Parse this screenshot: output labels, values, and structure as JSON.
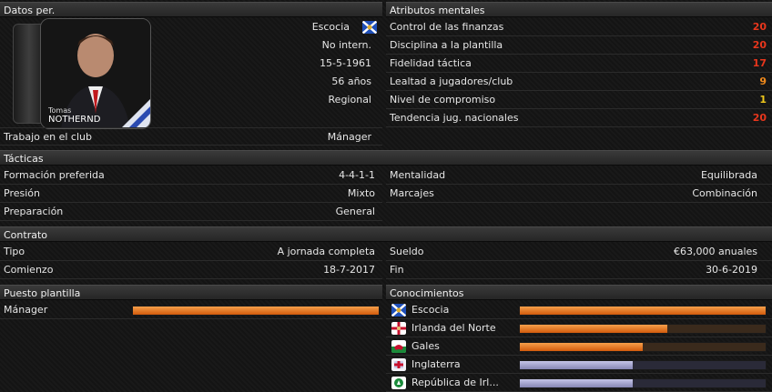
{
  "personal": {
    "header": "Datos per.",
    "nationality": "Escocia",
    "international": "No intern.",
    "birth_date": "15-5-1961",
    "age": "56 años",
    "reputation": "Regional",
    "photo_first_name": "Tomas",
    "photo_last_name": "NOTHERND",
    "job_label": "Trabajo en el club",
    "job_value": "Mánager"
  },
  "mental": {
    "header": "Atributos mentales",
    "items": [
      {
        "label": "Control de las finanzas",
        "value": "20",
        "color": "#e8361c"
      },
      {
        "label": "Disciplina a la plantilla",
        "value": "20",
        "color": "#e8361c"
      },
      {
        "label": "Fidelidad táctica",
        "value": "17",
        "color": "#e8361c"
      },
      {
        "label": "Lealtad a jugadores/club",
        "value": "9",
        "color": "#f08a1c"
      },
      {
        "label": "Nivel de compromiso",
        "value": "1",
        "color": "#f0c81c"
      },
      {
        "label": "Tendencia jug. nacionales",
        "value": "20",
        "color": "#e8361c"
      }
    ]
  },
  "tactics": {
    "header": "Tácticas",
    "formation_label": "Formación preferida",
    "formation_value": "4-4-1-1",
    "mentality_label": "Mentalidad",
    "mentality_value": "Equilibrada",
    "pressing_label": "Presión",
    "pressing_value": "Mixto",
    "marking_label": "Marcajes",
    "marking_value": "Combinación",
    "training_label": "Preparación",
    "training_value": "General"
  },
  "contract": {
    "header": "Contrato",
    "type_label": "Tipo",
    "type_value": "A jornada completa",
    "wage_label": "Sueldo",
    "wage_value": "€63,000 anuales",
    "start_label": "Comienzo",
    "start_value": "18-7-2017",
    "end_label": "Fin",
    "end_value": "30-6-2019"
  },
  "squad_role": {
    "header": "Puesto plantilla",
    "label": "Mánager",
    "fraction": 1.0
  },
  "knowledge": {
    "header": "Conocimientos",
    "items": [
      {
        "label": "Escocia",
        "fraction": 1.0,
        "color": "orange",
        "flag": "scotland-flag-icon"
      },
      {
        "label": "Irlanda del Norte",
        "fraction": 0.6,
        "color": "orange",
        "flag": "northern-ireland-flag-icon"
      },
      {
        "label": "Gales",
        "fraction": 0.5,
        "color": "orange",
        "flag": "wales-flag-icon"
      },
      {
        "label": "Inglaterra",
        "fraction": 0.46,
        "color": "blue",
        "flag": "england-flag-icon"
      },
      {
        "label": "República de Irl...",
        "fraction": 0.46,
        "color": "blue",
        "flag": "ireland-flag-icon"
      }
    ]
  }
}
